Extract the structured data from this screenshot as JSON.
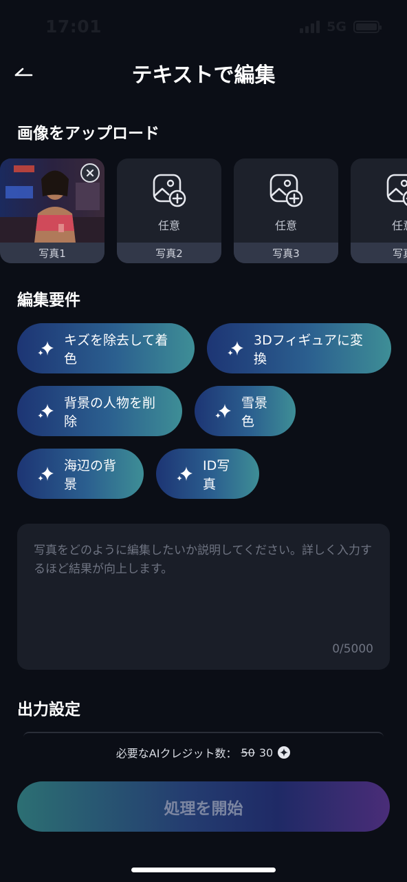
{
  "status": {
    "time": "17:01",
    "network": "5G"
  },
  "header": {
    "title": "テキストで編集",
    "back_icon": "back-arrow-icon"
  },
  "upload": {
    "section_title": "画像をアップロード",
    "cards": [
      {
        "label": "写真1",
        "filled": true
      },
      {
        "label": "写真2",
        "optional": "任意"
      },
      {
        "label": "写真3",
        "optional": "任意"
      },
      {
        "label": "写真",
        "optional": "任意"
      }
    ]
  },
  "requirements": {
    "section_title": "編集要件",
    "chips": [
      "キズを除去して着色",
      "3Dフィギュアに変換",
      "背景の人物を削除",
      "雪景色",
      "海辺の背景",
      "ID写真"
    ]
  },
  "prompt": {
    "placeholder": "写真をどのように編集したいか説明してください。詳しく入力するほど結果が向上します。",
    "counter": "0/5000"
  },
  "output": {
    "section_title": "出力設定"
  },
  "credits": {
    "label": "必要なAIクレジット数：",
    "old_value": "50",
    "new_value": "30"
  },
  "start_button": {
    "label": "処理を開始"
  },
  "colors": {
    "background": "#0b0e16",
    "card": "#1d212b",
    "chip_start": "#1d3574",
    "chip_end": "#3e8e96"
  }
}
